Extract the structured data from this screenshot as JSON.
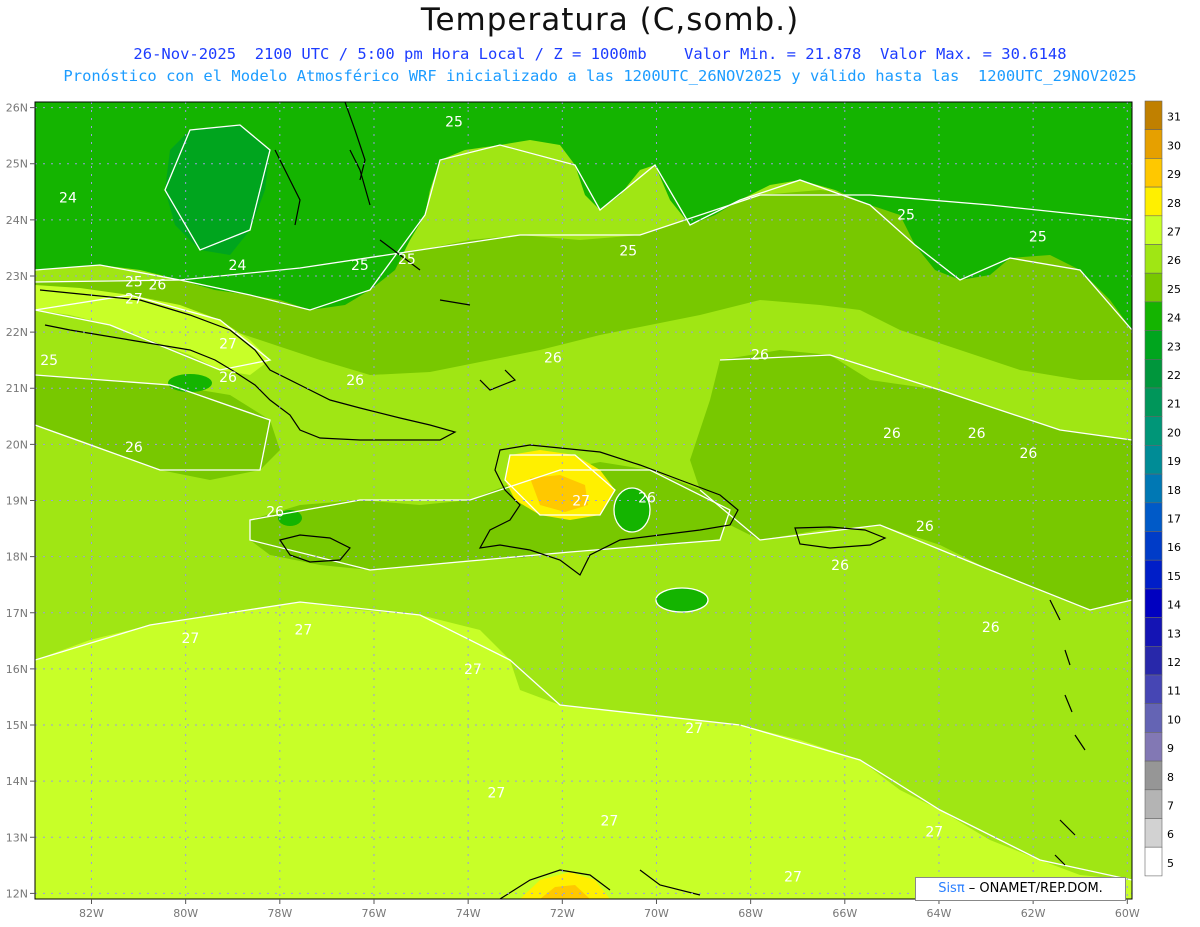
{
  "title": "Temperatura (C,somb.)",
  "subtitle_line1": "26-Nov-2025  2100 UTC / 5:00 pm Hora Local / Z = 1000mb    Valor Min. = 21.878  Valor Max. = 30.6148",
  "subtitle_line2": "Pronóstico con el Modelo Atmosférico WRF inicializado a las 1200UTC_26NOV2025 y válido hasta las  1200UTC_29NOV2025",
  "colors": {
    "subtitle1": "#1c3cff",
    "subtitle2": "#1c9cff",
    "contour": "#ffffff",
    "coast": "#000000",
    "grid": "#9a9ae0"
  },
  "map": {
    "lon_range": [
      -83.2,
      -59.9
    ],
    "lat_range": [
      11.9,
      26.1
    ],
    "lat_ticks": [
      {
        "value": 26,
        "label": "26N"
      },
      {
        "value": 25,
        "label": "25N"
      },
      {
        "value": 24,
        "label": "24N"
      },
      {
        "value": 23,
        "label": "23N"
      },
      {
        "value": 22,
        "label": "22N"
      },
      {
        "value": 21,
        "label": "21N"
      },
      {
        "value": 20,
        "label": "20N"
      },
      {
        "value": 19,
        "label": "19N"
      },
      {
        "value": 18,
        "label": "18N"
      },
      {
        "value": 17,
        "label": "17N"
      },
      {
        "value": 16,
        "label": "16N"
      },
      {
        "value": 15,
        "label": "15N"
      },
      {
        "value": 14,
        "label": "14N"
      },
      {
        "value": 13,
        "label": "13N"
      },
      {
        "value": 12,
        "label": "12N"
      }
    ],
    "lon_ticks": [
      {
        "value": -82,
        "label": "82W"
      },
      {
        "value": -80,
        "label": "80W"
      },
      {
        "value": -78,
        "label": "78W"
      },
      {
        "value": -76,
        "label": "76W"
      },
      {
        "value": -74,
        "label": "74W"
      },
      {
        "value": -72,
        "label": "72W"
      },
      {
        "value": -70,
        "label": "70W"
      },
      {
        "value": -68,
        "label": "68W"
      },
      {
        "value": -66,
        "label": "66W"
      },
      {
        "value": -64,
        "label": "64W"
      },
      {
        "value": -62,
        "label": "62W"
      },
      {
        "value": -60,
        "label": "60W"
      }
    ],
    "contour_labels": [
      {
        "text": "25",
        "lon": -74.3,
        "lat": 25.75
      },
      {
        "text": "24",
        "lon": -82.5,
        "lat": 24.4
      },
      {
        "text": "24",
        "lon": -78.9,
        "lat": 23.2
      },
      {
        "text": "25",
        "lon": -76.3,
        "lat": 23.2
      },
      {
        "text": "25",
        "lon": -75.3,
        "lat": 23.3
      },
      {
        "text": "25",
        "lon": -70.6,
        "lat": 23.45
      },
      {
        "text": "25",
        "lon": -64.7,
        "lat": 24.1
      },
      {
        "text": "25",
        "lon": -61.9,
        "lat": 23.7
      },
      {
        "text": "25",
        "lon": -81.1,
        "lat": 22.9
      },
      {
        "text": "26",
        "lon": -80.6,
        "lat": 22.85
      },
      {
        "text": "27",
        "lon": -81.1,
        "lat": 22.6
      },
      {
        "text": "25",
        "lon": -82.9,
        "lat": 21.5
      },
      {
        "text": "27",
        "lon": -79.1,
        "lat": 21.8
      },
      {
        "text": "26",
        "lon": -79.1,
        "lat": 21.2
      },
      {
        "text": "26",
        "lon": -76.4,
        "lat": 21.15
      },
      {
        "text": "26",
        "lon": -72.2,
        "lat": 21.55
      },
      {
        "text": "26",
        "lon": -67.8,
        "lat": 21.6
      },
      {
        "text": "26",
        "lon": -81.1,
        "lat": 19.95
      },
      {
        "text": "26",
        "lon": -65.0,
        "lat": 20.2
      },
      {
        "text": "26",
        "lon": -63.2,
        "lat": 20.2
      },
      {
        "text": "26",
        "lon": -62.1,
        "lat": 19.85
      },
      {
        "text": "26",
        "lon": -78.1,
        "lat": 18.8
      },
      {
        "text": "27",
        "lon": -71.6,
        "lat": 19.0
      },
      {
        "text": "26",
        "lon": -70.2,
        "lat": 19.05
      },
      {
        "text": "26",
        "lon": -64.3,
        "lat": 18.55
      },
      {
        "text": "26",
        "lon": -66.1,
        "lat": 17.85
      },
      {
        "text": "26",
        "lon": -62.9,
        "lat": 16.75
      },
      {
        "text": "27",
        "lon": -79.9,
        "lat": 16.55
      },
      {
        "text": "27",
        "lon": -77.5,
        "lat": 16.7
      },
      {
        "text": "27",
        "lon": -73.9,
        "lat": 16.0
      },
      {
        "text": "27",
        "lon": -69.2,
        "lat": 14.95
      },
      {
        "text": "27",
        "lon": -73.4,
        "lat": 13.8
      },
      {
        "text": "27",
        "lon": -71.0,
        "lat": 13.3
      },
      {
        "text": "27",
        "lon": -64.1,
        "lat": 13.1
      },
      {
        "text": "27",
        "lon": -67.1,
        "lat": 12.3
      }
    ]
  },
  "colorbar": {
    "levels": [
      31,
      30,
      29,
      28,
      27,
      26,
      25,
      24,
      23,
      22,
      21,
      20,
      19,
      18,
      17,
      16,
      15,
      14,
      13,
      12,
      11,
      10,
      9,
      8,
      7,
      6,
      5
    ],
    "colors": [
      "#c08000",
      "#e6a000",
      "#ffc800",
      "#fff000",
      "#c8ff28",
      "#a0e614",
      "#78c800",
      "#14b400",
      "#00a51e",
      "#00963c",
      "#00965a",
      "#009678",
      "#008c96",
      "#0078b4",
      "#005ac8",
      "#003cc8",
      "#001ec8",
      "#0000c0",
      "#1414b4",
      "#2828aa",
      "#4646b4",
      "#6464b4",
      "#8278b4",
      "#969696",
      "#b4b4b4",
      "#d2d2d2",
      "#ffffff"
    ]
  },
  "credit": {
    "logo": "Sisπ",
    "text": " – ONAMET/REP.DOM."
  }
}
